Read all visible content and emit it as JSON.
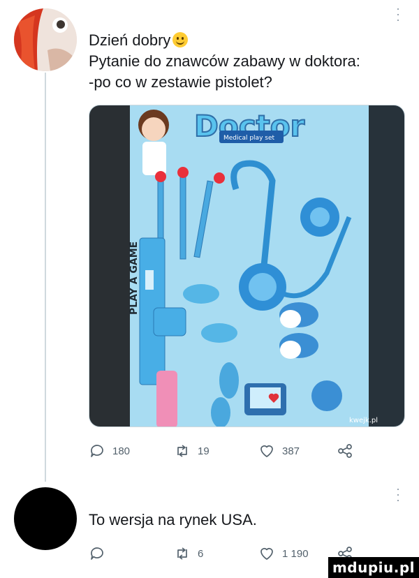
{
  "tweet1": {
    "lines": [
      "Dzień dobry",
      "Pytanie do znawców zabawy w doktora:",
      "-po co w zestawie pistolet?"
    ],
    "emoji": "slightly-smiling-face",
    "media": {
      "box_title": "Doctor",
      "box_subtitle": "Medical play set",
      "side_text": "PLAY A GAME",
      "source": "kwejk.pl"
    },
    "actions": {
      "replies": "180",
      "retweets": "19",
      "likes": "387"
    }
  },
  "tweet2": {
    "text": "To wersja na rynek USA.",
    "actions": {
      "retweets": "6",
      "likes": "1 190"
    }
  },
  "watermark": "mdupiu.pl",
  "colors": {
    "text": "#0f1419",
    "muted": "#53616c",
    "thread": "#cfd9de",
    "toy_blue": "#3fa6de"
  },
  "icons": [
    "more-icon",
    "reply-icon",
    "retweet-icon",
    "like-icon",
    "share-icon",
    "emoji-icon"
  ]
}
